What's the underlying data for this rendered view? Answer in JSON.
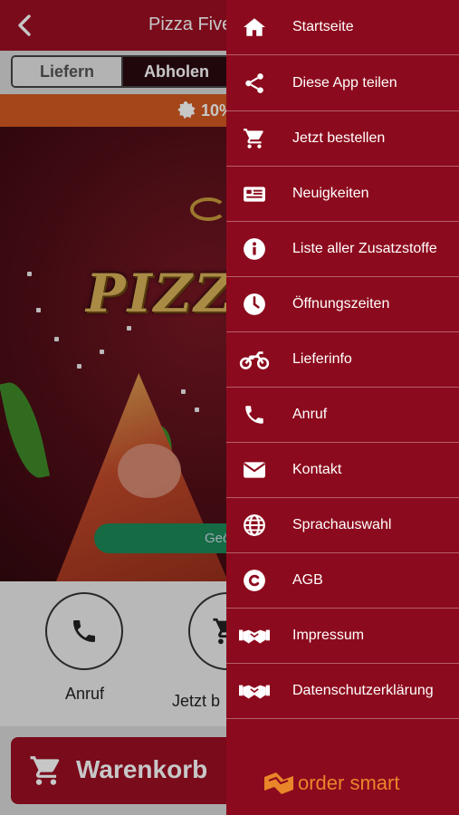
{
  "header": {
    "title": "Pizza Five",
    "back_icon": "chevron-left-icon"
  },
  "order_mode": {
    "options": [
      "Liefern",
      "Abholen"
    ],
    "selected": "Abholen"
  },
  "promo": {
    "text": "10%",
    "icon": "badge-icon"
  },
  "hero": {
    "logo_text": "PIZZA",
    "status_text": "Geö"
  },
  "actions": [
    {
      "label": "Anruf",
      "icon": "phone-icon"
    },
    {
      "label": "Jetzt b",
      "icon": "cart-icon"
    }
  ],
  "cart": {
    "label": "Warenkorb",
    "icon": "cart-icon"
  },
  "menu": {
    "items": [
      {
        "label": "Startseite",
        "icon": "home-icon"
      },
      {
        "label": "Diese App teilen",
        "icon": "share-icon"
      },
      {
        "label": "Jetzt bestellen",
        "icon": "cart-icon"
      },
      {
        "label": "Neuigkeiten",
        "icon": "news-icon"
      },
      {
        "label": "Liste aller Zusatzstoffe",
        "icon": "info-icon"
      },
      {
        "label": "Öffnungszeiten",
        "icon": "clock-icon"
      },
      {
        "label": "Lieferinfo",
        "icon": "motorbike-icon"
      },
      {
        "label": "Anruf",
        "icon": "phone-icon"
      },
      {
        "label": "Kontakt",
        "icon": "envelope-icon"
      },
      {
        "label": "Sprachauswahl",
        "icon": "globe-icon"
      },
      {
        "label": "AGB",
        "icon": "copyright-icon"
      },
      {
        "label": "Impressum",
        "icon": "handshake-icon"
      },
      {
        "label": "Datenschutzerklärung",
        "icon": "handshake-icon"
      }
    ],
    "brand": "order smart"
  },
  "colors": {
    "primary": "#9b0f23",
    "drawer": "#8c0a1d",
    "promo": "#d25a22",
    "status": "#1c8a56",
    "brand": "#e9862a"
  }
}
